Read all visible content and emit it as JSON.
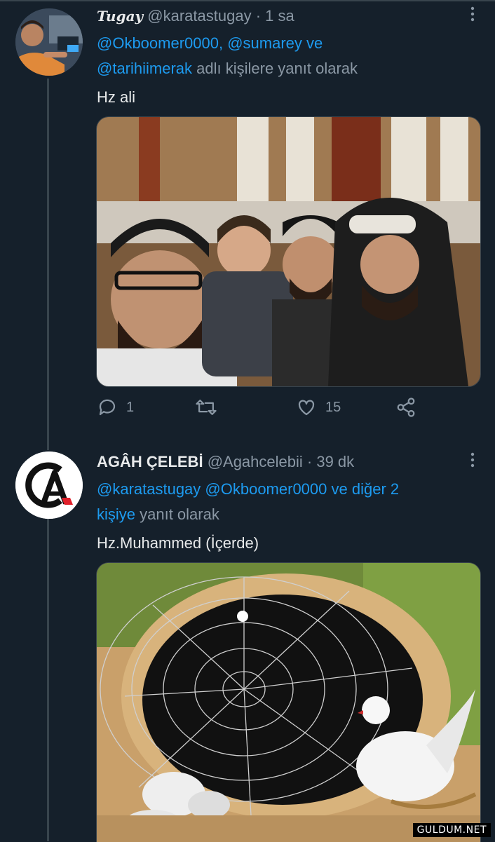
{
  "tweet1": {
    "display_name": "Tugay",
    "handle": "@karatastugay",
    "time": "· 1 sa",
    "reply_mentions_line1": "@Okboomer0000, @sumarey ve",
    "reply_mention_last": "@tarihiimerak",
    "reply_suffix": " adlı kişilere yanıt olarak",
    "text": "Hz ali",
    "replies": "1",
    "retweets": "",
    "likes": "15",
    "more_icon": "more-dots-icon"
  },
  "tweet2": {
    "display_name": "AGÂH ÇELEBİ",
    "handle": "@Agahcelebii",
    "time": "· 39 dk",
    "reply_mentions": "@karatastugay @Okboomer0000 ve diğer 2",
    "reply_mentions_cont": "kişiye",
    "reply_suffix": " yanıt olarak",
    "text": "Hz.Muhammed (İçerde)"
  },
  "watermark": "GULDUM.NET",
  "colors": {
    "background": "#15202b",
    "accent": "#1d9bf0",
    "muted": "#8b98a5",
    "divider": "#38444d"
  }
}
